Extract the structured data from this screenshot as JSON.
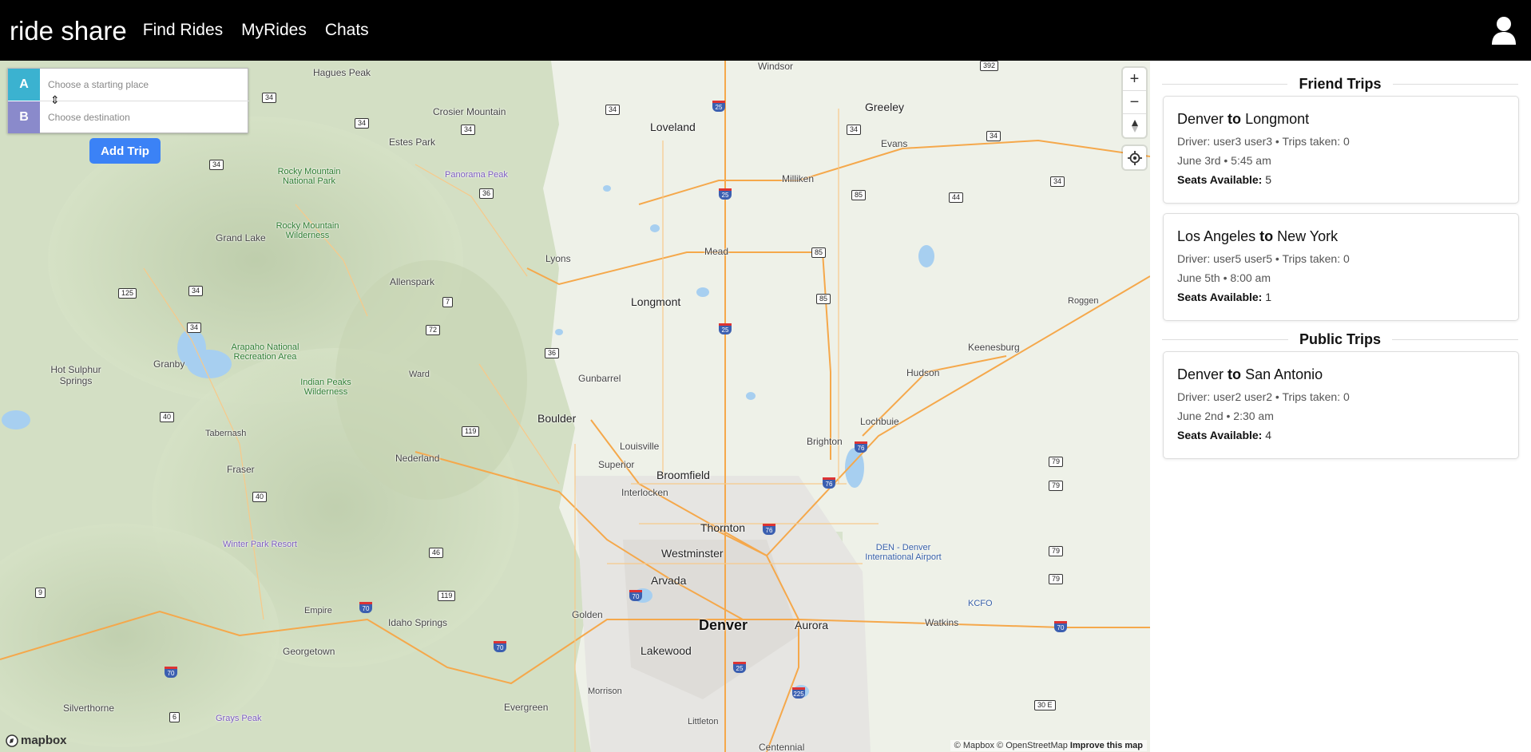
{
  "navbar": {
    "brand": "ride share",
    "links": [
      "Find Rides",
      "MyRides",
      "Chats"
    ],
    "user_icon": "user-icon"
  },
  "directions": {
    "a_letter": "A",
    "b_letter": "B",
    "a_placeholder": "Choose a starting place",
    "b_placeholder": "Choose destination",
    "swap_icon": "swap-vertical-icon",
    "add_trip": "Add Trip"
  },
  "map": {
    "attribution_mapbox": "© Mapbox",
    "attribution_osm": "© OpenStreetMap",
    "improve": "Improve this map",
    "logo": "mapbox",
    "zoom_in": "+",
    "zoom_out": "−",
    "colors": {
      "accent": "#3b82f6",
      "a_color": "#3bb2d0",
      "b_color": "#8a8acb"
    },
    "places": [
      "Windsor",
      "Hagues Peak",
      "Crosier Mountain",
      "Loveland",
      "Greeley",
      "Estes Park",
      "Evans",
      "Panorama Peak",
      "Rocky Mountain National Park",
      "Milliken",
      "Rocky Mountain Wilderness",
      "Grand Lake",
      "Mead",
      "Lyons",
      "Allenspark",
      "Longmont",
      "Roggen",
      "Keenesburg",
      "Arapaho National Recreation Area",
      "Granby",
      "Hot Sulphur Springs",
      "Ward",
      "Indian Peaks Wilderness",
      "Gunbarrel",
      "Hudson",
      "Boulder",
      "Lochbuie",
      "Tabernash",
      "Nederland",
      "Louisville",
      "Brighton",
      "Superior",
      "Broomfield",
      "Fraser",
      "Interlocken",
      "Thornton",
      "Winter Park Resort",
      "Westminster",
      "DEN - Denver International Airport",
      "Arvada",
      "KCFO",
      "Empire",
      "Idaho Springs",
      "Golden",
      "Watkins",
      "Denver",
      "Aurora",
      "Georgetown",
      "Lakewood",
      "Silverthorne",
      "Evergreen",
      "Morrison",
      "Grays Peak",
      "Littleton",
      "Centennial"
    ]
  },
  "sidebar": {
    "friend_heading": "Friend Trips",
    "public_heading": "Public Trips",
    "to_word": "to",
    "seats_label": "Seats Available:",
    "friend_trips": [
      {
        "from": "Denver",
        "to": "Longmont",
        "driver_line": "Driver: user3 user3 • Trips taken: 0",
        "date_line": "June 3rd • 5:45 am",
        "seats": "5"
      },
      {
        "from": "Los Angeles",
        "to": "New York",
        "driver_line": "Driver: user5 user5 • Trips taken: 0",
        "date_line": "June 5th • 8:00 am",
        "seats": "1"
      }
    ],
    "public_trips": [
      {
        "from": "Denver",
        "to": "San Antonio",
        "driver_line": "Driver: user2 user2 • Trips taken: 0",
        "date_line": "June 2nd • 2:30 am",
        "seats": "4"
      }
    ]
  }
}
